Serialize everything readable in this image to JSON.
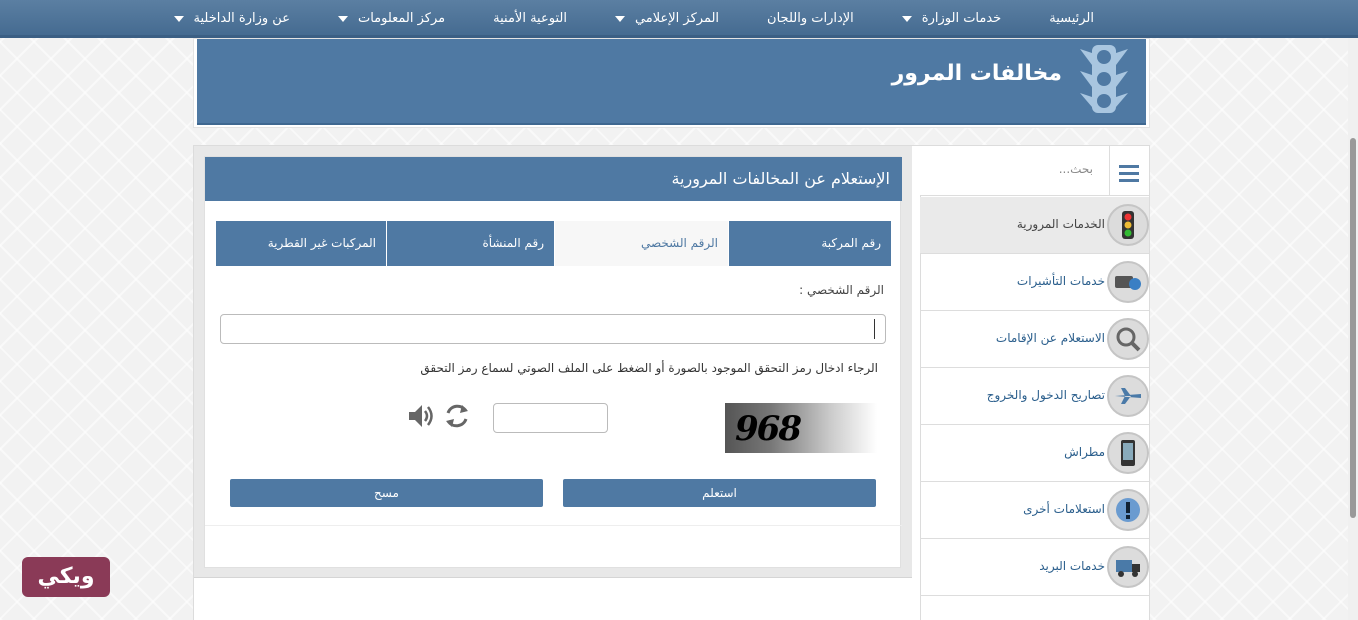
{
  "nav": {
    "items": [
      {
        "label": "الرئيسية",
        "dropdown": false
      },
      {
        "label": "خدمات الوزارة",
        "dropdown": true
      },
      {
        "label": "الإدارات واللجان",
        "dropdown": false
      },
      {
        "label": "المركز الإعلامي",
        "dropdown": true
      },
      {
        "label": "التوعية الأمنية",
        "dropdown": false
      },
      {
        "label": "مركز المعلومات",
        "dropdown": true
      },
      {
        "label": "عن وزارة الداخلية",
        "dropdown": true
      }
    ]
  },
  "banner": {
    "title": "مخالفات المرور",
    "icon": "traffic-light-icon"
  },
  "panel": {
    "title": "الإستعلام عن المخالفات المرورية",
    "tabs": [
      {
        "label": "رقم المركبة",
        "active": false
      },
      {
        "label": "الرقم الشخصي",
        "active": true
      },
      {
        "label": "رقم المنشأة",
        "active": false
      },
      {
        "label": "المركبات غير القطرية",
        "active": false
      }
    ],
    "field_label": "الرقم الشخصي :",
    "field_value": "",
    "captcha_hint": "الرجاء ادخال رمز التحقق الموجود بالصورة أو الضغط على الملف الصوتي لسماع رمز التحقق",
    "captcha_code": "968",
    "captcha_value": "",
    "query_button": "استعلم",
    "clear_button": "مسح"
  },
  "sidebar": {
    "search_placeholder": "بحث...",
    "items": [
      {
        "label": "الخدمات المرورية",
        "icon": "traffic-light-icon",
        "active": true
      },
      {
        "label": "خدمات التأشيرات",
        "icon": "visa-icon",
        "active": false
      },
      {
        "label": "الاستعلام عن الإقامات",
        "icon": "residency-search-icon",
        "active": false
      },
      {
        "label": "تصاريح الدخول والخروج",
        "icon": "airplane-icon",
        "active": false
      },
      {
        "label": "مطراش",
        "icon": "metrash-phone-icon",
        "active": false
      },
      {
        "label": "استعلامات أخرى",
        "icon": "info-icon",
        "active": false
      },
      {
        "label": "خدمات البريد",
        "icon": "mail-truck-icon",
        "active": false
      }
    ]
  },
  "watermark": {
    "text": "ويكي"
  },
  "colors": {
    "primary": "#4f79a3",
    "nav": "#456b91",
    "logo": "#8a3a57"
  }
}
